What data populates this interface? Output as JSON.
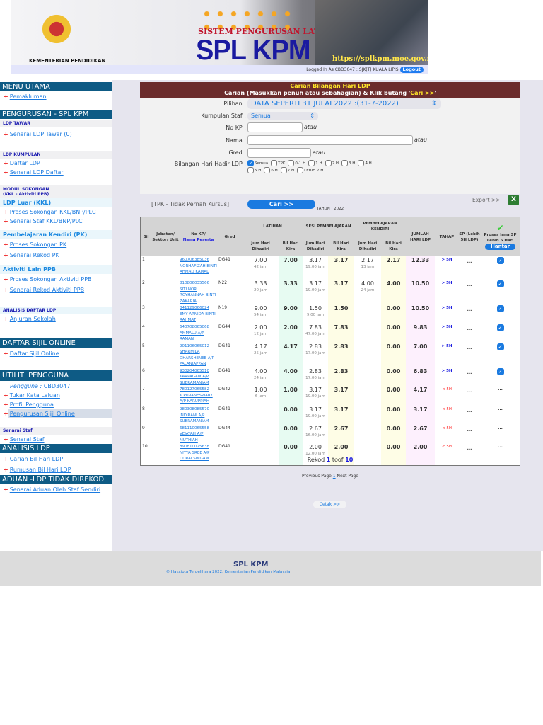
{
  "header": {
    "ministry": "KEMENTERIAN PENDIDIKAN",
    "system_title": "SISTEM PENGURUSAN LATIHAN",
    "app_name": "SPL KPM",
    "url": "https://splkpm.moe.gov.my",
    "logged_in": "Logged In As CBD3047 : SJK(T) KUALA LIPIS",
    "logout": "Logout"
  },
  "sidebar": {
    "menu_utama": "MENU UTAMA",
    "pemakluman": "Pemakluman",
    "pengurusan": "PENGURUSAN - SPL KPM",
    "ldp_tawar": "LDP TAWAR",
    "senarai_ldp_tawar": "Senarai LDP Tawar (0)",
    "ldp_kumpulan": "LDP KUMPULAN",
    "daftar_ldp": "Daftar LDP",
    "senarai_ldp_daftar": "Senarai LDP Daftar",
    "modul_sokongan": "MODUL SOKONGAN",
    "modul_sokongan_sub": "(KKL - Aktiviti PPB)",
    "ldp_luar": "LDP Luar (KKL)",
    "proses_kkl": "Proses Sokongan KKL/BNP/PLC",
    "senarai_staf_kkl": "Senarai Staf KKL/BNP/PLC",
    "pk": "Pembelajaran Kendiri (PK)",
    "proses_pk": "Proses Sokongan PK",
    "senarai_rekod_pk": "Senarai Rekod PK",
    "aktiviti_lain": "Aktiviti Lain PPB",
    "proses_ppb": "Proses Sokongan Aktiviti PPB",
    "senarai_rekod_ppb": "Senarai Rekod Aktiviti PPB",
    "analisis_daftar": "ANALISIS DAFTAR LDP",
    "anjuran_sekolah": "Anjuran Sekolah",
    "daftar_sijil": "DAFTAR SIJIL ONLINE",
    "daftar_sijil_online": "Daftar Sijil Online",
    "utiliti": "UTILITI PENGGUNA",
    "pengguna_label": "Pengguna :",
    "pengguna_id": "CBD3047",
    "tukar_kata": "Tukar Kata Laluan",
    "profil": "Profil Pengguna",
    "pengurusan_sijil": "Pengurusan Sijil Online",
    "senarai_staf_head": "Senarai Staf",
    "senarai_staf": "Senarai Staf",
    "analisis_ldp": "ANALISIS LDP",
    "carian_bil": "Carian Bil Hari LDP",
    "rumusan_bil": "Rumusan Bil Hari LDP",
    "aduan": "ADUAN -LDP TIDAK DIREKOD",
    "senarai_aduan": "Senarai Aduan Oleh Staf Sendiri"
  },
  "form": {
    "title": "Carian Bilangan Hari LDP",
    "subtitle_a": "Carian (Masukkan penuh atau sebahagian) & Klik butang '",
    "subtitle_b": "Cari >>",
    "subtitle_c": "'",
    "pilihan_label": "Pilihan :",
    "pilihan_value": "DATA SEPERTI 31 JULAI 2022 :(31-7-2022)",
    "kumpulan_label": "Kumpulan Staf :",
    "kumpulan_value": "Semua",
    "nokp_label": "No KP :",
    "nama_label": "Nama :",
    "gred_label": "Gred :",
    "atau": "atau",
    "bilangan_label": "Bilangan Hari Hadir LDP :",
    "options": [
      "Semua",
      "TPK",
      "0-1 H",
      "1 H",
      "2 H",
      "3 H",
      "4 H",
      "5 H",
      "6 H",
      "7 H",
      "LEBIH 7 H"
    ],
    "tpk_note": "[TPK - Tidak Pernah Kursus]",
    "cari": "Cari    >>"
  },
  "export": "Export >>",
  "tahun": "TAHUN : 2022",
  "table": {
    "h_bil": "Bil",
    "h_jabatan": "Jabatan/ Sektor/ Unit",
    "h_nokp": "No KP/",
    "h_nama": "Nama Peserta",
    "h_gred": "Gred",
    "h_latihan": "LATIHAN",
    "h_sesi": "SESI PEMBELAJARAN",
    "h_pk": "PEMBELAJARAN KENDIRI",
    "h_jumhari": "Jum Hari Dihadiri",
    "h_bilhari": "Bil Hari Kira",
    "h_jumlah": "JUMLAH HARI LDP",
    "h_tahap": "TAHAP",
    "h_sp": "SP (Lebih 5H LDP)",
    "h_proses": "Proses Jana SP Lebih 5 Hari",
    "hantar": "Hantar",
    "rows": [
      {
        "bil": "1",
        "kp": "960706385036",
        "nama": "NORHAFIZAH BINTI AHMAD KAMAL",
        "gred": "DG41",
        "lj": "7.00",
        "ljam": "42 jam",
        "lb": "7.00",
        "sj": "3.17",
        "sjam": "19.00 jam",
        "sb": "3.17",
        "pj": "2.17",
        "pjam": "13 jam",
        "pb": "2.17",
        "jumlah": "12.33",
        "tahap": "> 5H",
        "sp": "...",
        "proses": "checked"
      },
      {
        "bil": "2",
        "kp": "810806035566",
        "nama": "SITI NOR ROYHANNAH BINTI ZAKARIA",
        "gred": "N22",
        "lj": "3.33",
        "ljam": "20 jam",
        "lb": "3.33",
        "sj": "3.17",
        "sjam": "19.00 jam",
        "sb": "3.17",
        "pj": "4.00",
        "pjam": "24 jam",
        "pb": "4.00",
        "jumlah": "10.50",
        "tahap": "> 5H",
        "sp": "...",
        "proses": "checked"
      },
      {
        "bil": "3",
        "kp": "841129066024",
        "nama": "EMY ARNIDA BINTI RAHMAT",
        "gred": "N19",
        "lj": "9.00",
        "ljam": "54 jam",
        "lb": "9.00",
        "sj": "1.50",
        "sjam": "9.00 jam",
        "sb": "1.50",
        "pj": "",
        "pjam": "",
        "pb": "0.00",
        "jumlah": "10.50",
        "tahap": "> 5H",
        "sp": "...",
        "proses": "checked"
      },
      {
        "bil": "4",
        "kp": "640708065068",
        "nama": "AMMALU A/P RAMAN",
        "gred": "DG44",
        "lj": "2.00",
        "ljam": "12 jam",
        "lb": "2.00",
        "sj": "7.83",
        "sjam": "47.00 jam",
        "sb": "7.83",
        "pj": "",
        "pjam": "",
        "pb": "0.00",
        "jumlah": "9.83",
        "tahap": "> 5H",
        "sp": "...",
        "proses": "checked"
      },
      {
        "bil": "5",
        "kp": "901106065012",
        "nama": "SHARMILA DHARSHENEE A/P PALANIAPPAN",
        "gred": "DG41",
        "lj": "4.17",
        "ljam": "25 jam",
        "lb": "4.17",
        "sj": "2.83",
        "sjam": "17.00 jam",
        "sb": "2.83",
        "pj": "",
        "pjam": "",
        "pb": "0.00",
        "jumlah": "7.00",
        "tahap": "> 5H",
        "sp": "...",
        "proses": "checked"
      },
      {
        "bil": "6",
        "kp": "930204065510",
        "nama": "KARPAGAM A/P SUBRAMANIAM",
        "gred": "DG41",
        "lj": "4.00",
        "ljam": "24 jam",
        "lb": "4.00",
        "sj": "2.83",
        "sjam": "17.00 jam",
        "sb": "2.83",
        "pj": "",
        "pjam": "",
        "pb": "0.00",
        "jumlah": "6.83",
        "tahap": "> 5H",
        "sp": "...",
        "proses": "checked"
      },
      {
        "bil": "7",
        "kp": "780127065582",
        "nama": "K PUVANESWARY A/P KARUPPIAH",
        "gred": "DG42",
        "lj": "1.00",
        "ljam": "6 jam",
        "lb": "1.00",
        "sj": "3.17",
        "sjam": "19.00 jam",
        "sb": "3.17",
        "pj": "",
        "pjam": "",
        "pb": "0.00",
        "jumlah": "4.17",
        "tahap": "< 5H",
        "sp": "...",
        "proses": "..."
      },
      {
        "bil": "8",
        "kp": "980308085570",
        "nama": "INDIRANI A/P SUBRAMANIAM",
        "gred": "DG41",
        "lj": "",
        "ljam": "",
        "lb": "0.00",
        "sj": "3.17",
        "sjam": "19.00 jam",
        "sb": "3.17",
        "pj": "",
        "pjam": "",
        "pb": "0.00",
        "jumlah": "3.17",
        "tahap": "< 5H",
        "sp": "...",
        "proses": "..."
      },
      {
        "bil": "9",
        "kp": "681110065558",
        "nama": "VEJAYAH A/P MUTHIAH",
        "gred": "DG44",
        "lj": "",
        "ljam": "",
        "lb": "0.00",
        "sj": "2.67",
        "sjam": "16.00 jam",
        "sb": "2.67",
        "pj": "",
        "pjam": "",
        "pb": "0.00",
        "jumlah": "2.67",
        "tahap": "< 5H",
        "sp": "...",
        "proses": "..."
      },
      {
        "bil": "10",
        "kp": "890810025638",
        "nama": "NITYA SREE A/P DORAI SINGAM",
        "gred": "DG41",
        "lj": "",
        "ljam": "",
        "lb": "0.00",
        "sj": "2.00",
        "sjam": "12.00 jam",
        "sb": "2.00",
        "pj": "",
        "pjam": "",
        "pb": "0.00",
        "jumlah": "2.00",
        "tahap": "< 5H",
        "sp": "...",
        "proses": "..."
      }
    ]
  },
  "pagination": {
    "rekod": "Rekod",
    "from": "1",
    "toof": "toof",
    "to": "10",
    "prev": "Previous Page",
    "page": "1",
    "next": "Next Page"
  },
  "cetak": "Cetak >>",
  "footer": {
    "title": "SPL KPM",
    "copyright": "© Hakcipta Terpelihara 2022, Kementerian Pendidikan Malaysia"
  }
}
